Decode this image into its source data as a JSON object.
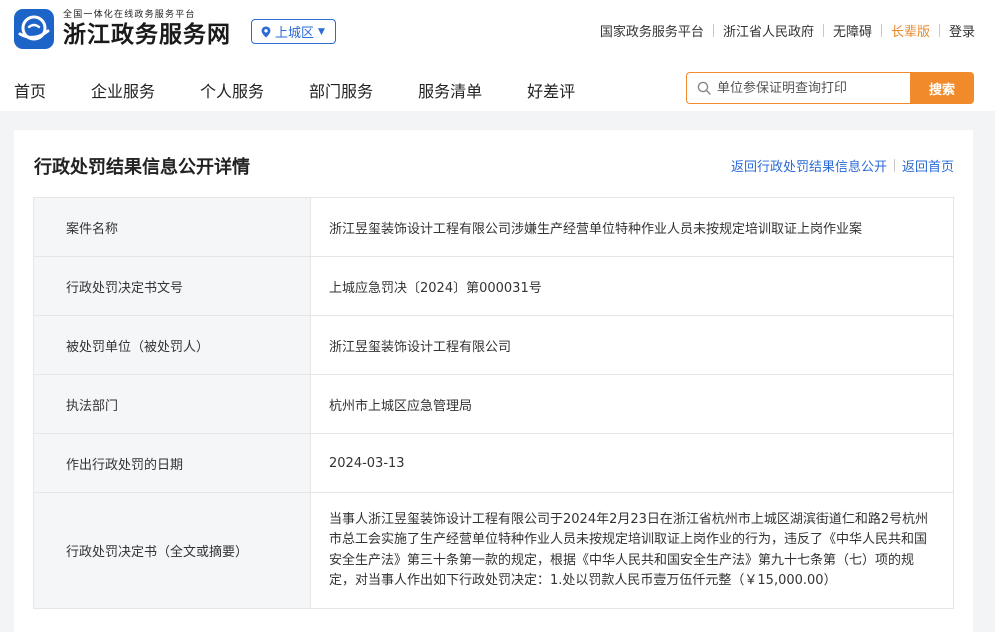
{
  "header": {
    "logo_sub": "全国一体化在线政务服务平台",
    "logo_main": "浙江政务服务网",
    "region": "上城区",
    "links": [
      "国家政务服务平台",
      "浙江省人民政府",
      "无障碍",
      "长辈版",
      "登录"
    ]
  },
  "nav": [
    "首页",
    "企业服务",
    "个人服务",
    "部门服务",
    "服务清单",
    "好差评"
  ],
  "search": {
    "placeholder": "单位参保证明查询打印",
    "button": "搜索"
  },
  "page": {
    "title": "行政处罚结果信息公开详情",
    "link_back_list": "返回行政处罚结果信息公开",
    "link_home": "返回首页"
  },
  "details": [
    {
      "label": "案件名称",
      "value": "浙江昱玺装饰设计工程有限公司涉嫌生产经营单位特种作业人员未按规定培训取证上岗作业案"
    },
    {
      "label": "行政处罚决定书文号",
      "value": "上城应急罚决〔2024〕第000031号"
    },
    {
      "label": "被处罚单位（被处罚人）",
      "value": "浙江昱玺装饰设计工程有限公司"
    },
    {
      "label": "执法部门",
      "value": "杭州市上城区应急管理局"
    },
    {
      "label": "作出行政处罚的日期",
      "value": "2024-03-13"
    },
    {
      "label": "行政处罚决定书（全文或摘要）",
      "value": "当事人浙江昱玺装饰设计工程有限公司于2024年2月23日在浙江省杭州市上城区湖滨街道仁和路2号杭州市总工会实施了生产经营单位特种作业人员未按规定培训取证上岗作业的行为，违反了《中华人民共和国安全生产法》第三十条第一款的规定，根据《中华人民共和国安全生产法》第九十七条第（七）项的规定，对当事人作出如下行政处罚决定：1.处以罚款人民币壹万伍仟元整（￥15,000.00）"
    }
  ],
  "colors": {
    "brand_blue": "#1c64c7",
    "link_blue": "#2a6bd6",
    "accent_orange": "#f08a2a"
  },
  "icons": {
    "logo": "zj-logo-icon",
    "region": "location-pin-icon",
    "search": "search-icon"
  }
}
